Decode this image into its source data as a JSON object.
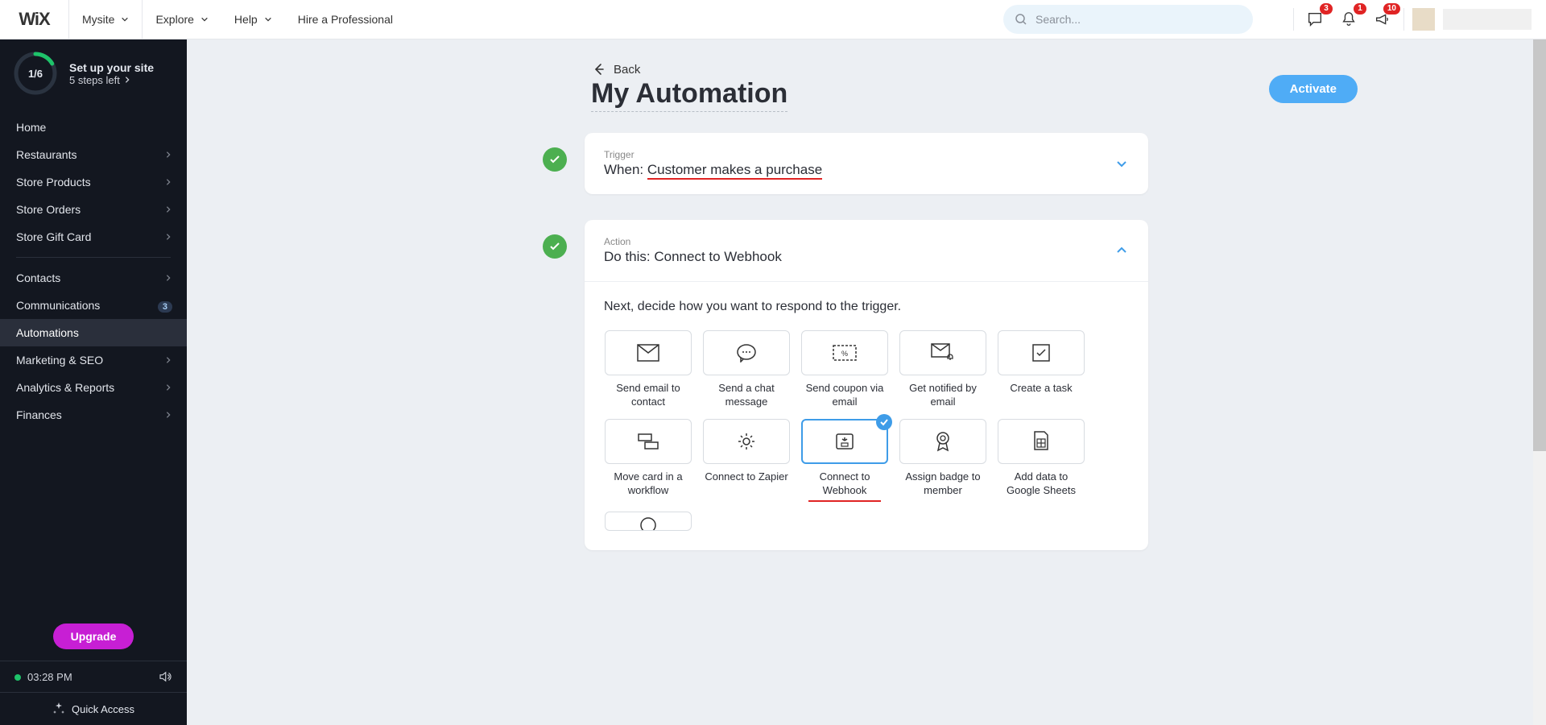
{
  "topbar": {
    "logo": "WiX",
    "mysite": "Mysite",
    "explore": "Explore",
    "help": "Help",
    "hire": "Hire a Professional",
    "search_placeholder": "Search...",
    "badges": {
      "chat": "3",
      "bell": "1",
      "speaker": "10"
    }
  },
  "setup": {
    "progress": "1/6",
    "title": "Set up your site",
    "subtitle": "5 steps left"
  },
  "sidebar": {
    "items": [
      {
        "label": "Home",
        "chevron": false
      },
      {
        "label": "Restaurants",
        "chevron": true
      },
      {
        "label": "Store Products",
        "chevron": true
      },
      {
        "label": "Store Orders",
        "chevron": true
      },
      {
        "label": "Store Gift Card",
        "chevron": true
      },
      {
        "sep": true
      },
      {
        "label": "Contacts",
        "chevron": true
      },
      {
        "label": "Communications",
        "chevron": true,
        "badge": "3"
      },
      {
        "label": "Automations",
        "chevron": false,
        "active": true
      },
      {
        "label": "Marketing & SEO",
        "chevron": true
      },
      {
        "label": "Analytics & Reports",
        "chevron": true
      },
      {
        "label": "Finances",
        "chevron": true
      }
    ],
    "upgrade": "Upgrade",
    "time": "03:28 PM",
    "quick_access": "Quick Access"
  },
  "page": {
    "back": "Back",
    "title": "My Automation",
    "activate": "Activate"
  },
  "trigger_card": {
    "label": "Trigger",
    "prefix": "When: ",
    "value": "Customer makes a purchase"
  },
  "action_card": {
    "label": "Action",
    "prefix": "Do this: ",
    "value": "Connect to Webhook",
    "helper": "Next, decide how you want to respond to the trigger.",
    "options": [
      {
        "name": "Send email to contact",
        "icon": "mail"
      },
      {
        "name": "Send a chat message",
        "icon": "chat"
      },
      {
        "name": "Send coupon via email",
        "icon": "coupon"
      },
      {
        "name": "Get notified by email",
        "icon": "mailbell"
      },
      {
        "name": "Create a task",
        "icon": "task"
      },
      {
        "name": "Move card in a workflow",
        "icon": "workflow"
      },
      {
        "name": "Connect to Zapier",
        "icon": "gear"
      },
      {
        "name": "Connect to Webhook",
        "icon": "webhook",
        "selected": true,
        "underline": true
      },
      {
        "name": "Assign badge to member",
        "icon": "badge"
      },
      {
        "name": "Add data to Google Sheets",
        "icon": "sheets"
      }
    ]
  }
}
